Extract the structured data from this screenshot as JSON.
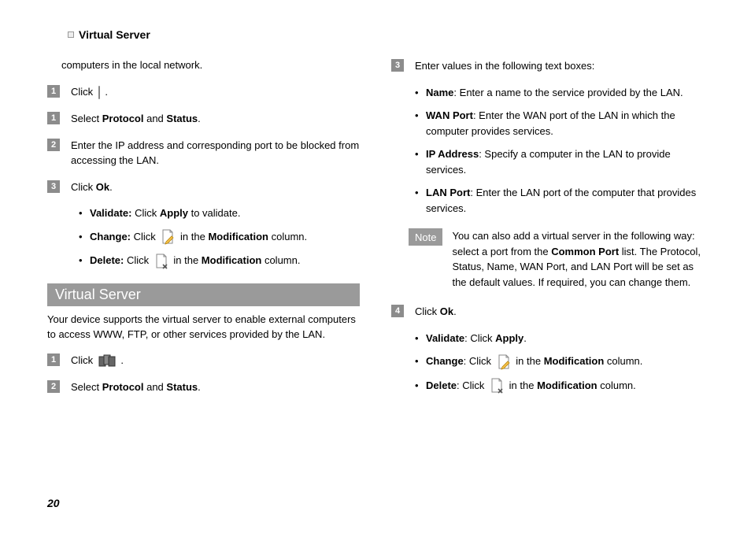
{
  "header": {
    "title": "Virtual Server"
  },
  "page_number": "20",
  "left": {
    "intro": "computers in the local network.",
    "step1a_num": "1",
    "step1a_pre": "Click ",
    "step1a_post": " .",
    "step1b_num": "1",
    "step1b_pre": "Select ",
    "step1b_b1": "Protocol",
    "step1b_mid": " and ",
    "step1b_b2": "Status",
    "step1b_post": ".",
    "step2_num": "2",
    "step2": "Enter the IP address and corresponding port to be blocked from accessing the LAN.",
    "step3_num": "3",
    "step3_pre": "Click ",
    "step3_b": "Ok",
    "step3_post": ".",
    "s3b1_b": "Validate:",
    "s3b1_mid": " Click ",
    "s3b1_b2": "Apply",
    "s3b1_post": " to validate.",
    "s3b2_b": "Change:",
    "s3b2_mid": " Click  ",
    "s3b2_mid2": "  in the ",
    "s3b2_b2": "Modification",
    "s3b2_post": " column.",
    "s3b3_b": "Delete:",
    "s3b3_mid": " Click  ",
    "s3b3_mid2": "  in the ",
    "s3b3_b2": "Modification",
    "s3b3_post": " column.",
    "section_title": "Virtual Server",
    "section_intro": "Your device supports the virtual server to enable external computers to access WWW, FTP, or other services provided by the LAN.",
    "vs1_num": "1",
    "vs1_pre": "Click ",
    "vs1_post": " .",
    "vs2_num": "2",
    "vs2_pre": "Select ",
    "vs2_b1": "Protocol",
    "vs2_mid": " and ",
    "vs2_b2": "Status",
    "vs2_post": "."
  },
  "right": {
    "step3_num": "3",
    "step3": "Enter values in the following text boxes:",
    "b1_b": "Name",
    "b1_t": ": Enter a name to the service provided by the LAN.",
    "b2_b": "WAN Port",
    "b2_t": ": Enter the WAN port of the LAN in which the computer provides services.",
    "b3_b": "IP Address",
    "b3_t": ": Specify a computer in the LAN to provide services.",
    "b4_b": "LAN Port",
    "b4_t": ": Enter the LAN port of the computer that provides services.",
    "note_label": "Note",
    "note_t1": "You can also add a virtual server in the following way: select a port from the ",
    "note_b": "Common Port",
    "note_t2": " list. The Protocol, Status, Name, WAN Port, and LAN Port will be set as the default values. If required, you can change them.",
    "step4_num": "4",
    "step4_pre": "Click ",
    "step4_b": "Ok",
    "step4_post": ".",
    "s4b1_b": "Validate",
    "s4b1_mid": ": Click ",
    "s4b1_b2": "Apply",
    "s4b1_post": ".",
    "s4b2_b": "Change",
    "s4b2_mid": ": Click  ",
    "s4b2_mid2": "  in the ",
    "s4b2_b2": "Modification",
    "s4b2_post": " column.",
    "s4b3_b": "Delete",
    "s4b3_mid": ": Click  ",
    "s4b3_mid2": "  in the ",
    "s4b3_b2": "Modification",
    "s4b3_post": " column."
  }
}
